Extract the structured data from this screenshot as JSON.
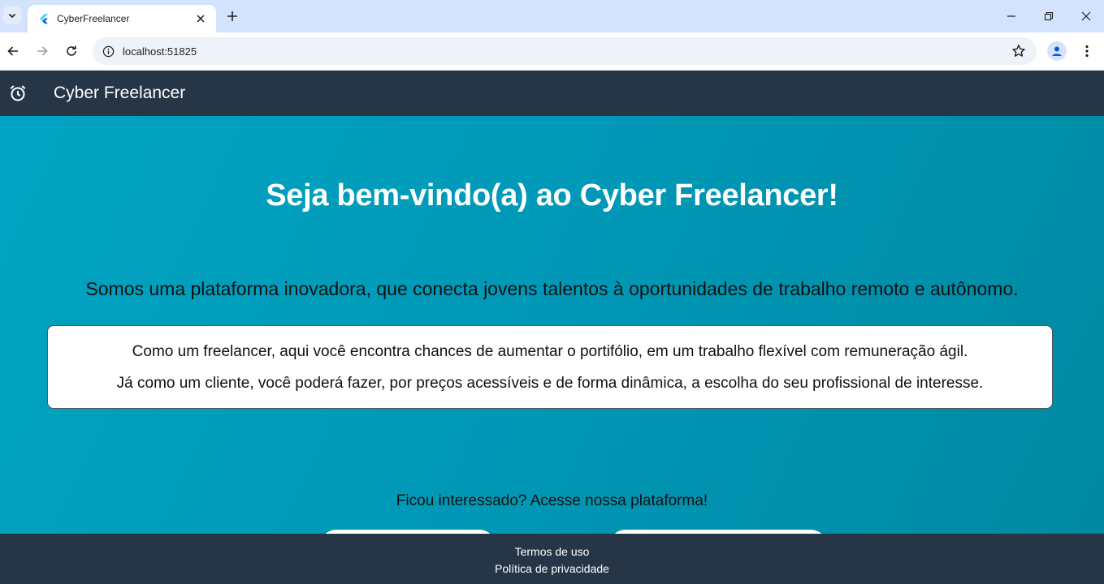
{
  "browser": {
    "tab": {
      "title": "CyberFreelancer",
      "favicon": "flutter-icon"
    },
    "url": "localhost:51825"
  },
  "app": {
    "title": "Cyber Freelancer",
    "leading_icon": "alarm-clock-icon"
  },
  "main": {
    "headline": "Seja bem-vindo(a) ao Cyber Freelancer!",
    "tagline": "Somos uma plataforma inovadora, que conecta jovens talentos à oportunidades de trabalho remoto e autônomo.",
    "card": {
      "line1": "Como um freelancer, aqui você encontra chances de aumentar o portifólio, em um trabalho flexível com remuneração ágil.",
      "line2": "Já como um cliente, você poderá fazer, por preços acessíveis e de forma dinâmica, a escolha do seu profissional de interesse."
    },
    "cta_text": "Ficou interessado? Acesse nossa plataforma!"
  },
  "footer": {
    "terms": "Termos de uso",
    "privacy": "Política de privacidade"
  },
  "colors": {
    "appbar": "#263646",
    "main_gradient_start": "#00a4c2",
    "main_gradient_end": "#0088a2",
    "tabstrip": "#d3e3fd"
  }
}
